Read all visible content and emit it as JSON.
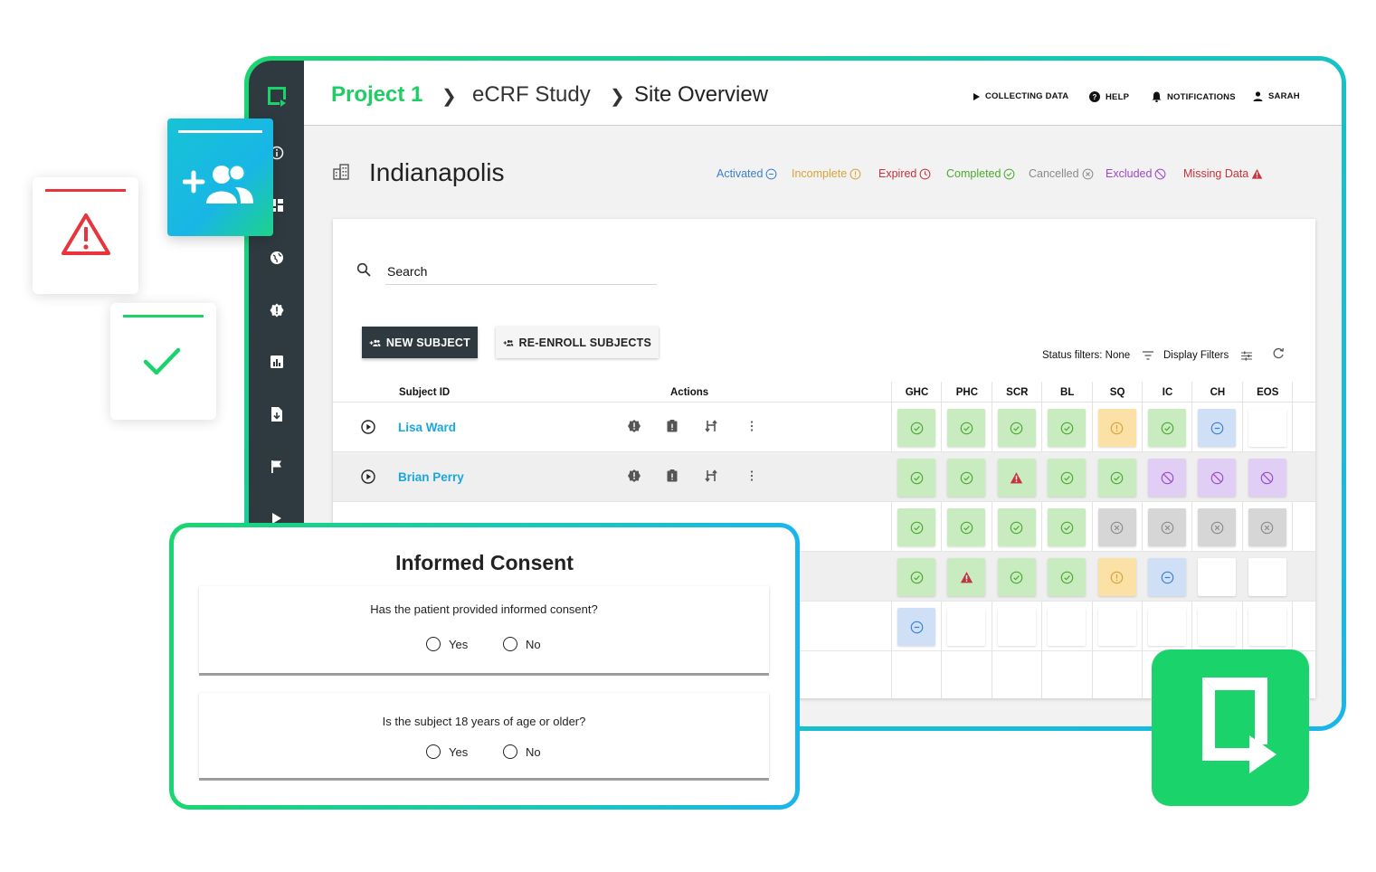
{
  "breadcrumb": [
    "Project 1",
    "eCRF Study",
    "Site Overview"
  ],
  "topnav": {
    "collecting": "COLLECTING DATA",
    "help": "HELP",
    "notifications": "NOTIFICATIONS",
    "user": "SARAH"
  },
  "site": {
    "title": "Indianapolis"
  },
  "legend": [
    {
      "label": "Activated",
      "color": "#3b7fcf",
      "icon": "minus-circle-icon"
    },
    {
      "label": "Incomplete",
      "color": "#d8a23a",
      "icon": "exclamation-circle-icon"
    },
    {
      "label": "Expired",
      "color": "#c6333a",
      "icon": "clock-icon"
    },
    {
      "label": "Completed",
      "color": "#4aa82e",
      "icon": "check-circle-icon"
    },
    {
      "label": "Cancelled",
      "color": "#8a8a8a",
      "icon": "x-circle-icon"
    },
    {
      "label": "Excluded",
      "color": "#9c49c9",
      "icon": "ban-icon"
    },
    {
      "label": "Missing Data",
      "color": "#c6333a",
      "icon": "warning-triangle-icon"
    }
  ],
  "search": {
    "label": "Search"
  },
  "buttons": {
    "new_subject": "NEW SUBJECT",
    "reenroll": "RE-ENROLL SUBJECTS"
  },
  "filters": {
    "status": "Status filters: None",
    "display": "Display Filters"
  },
  "table": {
    "subject_header": "Subject ID",
    "actions_header": "Actions",
    "columns": [
      "GHC",
      "PHC",
      "SCR",
      "BL",
      "SQ",
      "IC",
      "CH",
      "EOS"
    ],
    "rows": [
      {
        "name": "Lisa Ward",
        "cells": [
          "completed",
          "completed",
          "completed",
          "completed",
          "incomplete",
          "completed",
          "activated",
          "empty"
        ]
      },
      {
        "name": "Brian Perry",
        "cells": [
          "completed",
          "completed",
          "missing",
          "completed",
          "completed",
          "excluded",
          "excluded",
          "excluded"
        ]
      },
      {
        "name": "",
        "cells": [
          "completed",
          "completed",
          "completed",
          "completed",
          "cancelled",
          "cancelled",
          "cancelled",
          "cancelled"
        ]
      },
      {
        "name": "",
        "cells": [
          "completed",
          "missing",
          "completed",
          "completed",
          "incomplete",
          "activated",
          "empty",
          "empty"
        ]
      },
      {
        "name": "",
        "cells": [
          "activated",
          "empty",
          "empty",
          "empty",
          "empty",
          "empty",
          "empty",
          "empty"
        ]
      }
    ]
  },
  "consent": {
    "title": "Informed Consent",
    "q1": "Has the patient provided informed consent?",
    "q2": "Is the subject 18 years of age or older?",
    "yes": "Yes",
    "no": "No"
  },
  "colors": {
    "brand_green": "#1ad36b",
    "brand_blue": "#1ab6ea",
    "sidebar": "#2f3a40",
    "link": "#1aa7e0"
  }
}
